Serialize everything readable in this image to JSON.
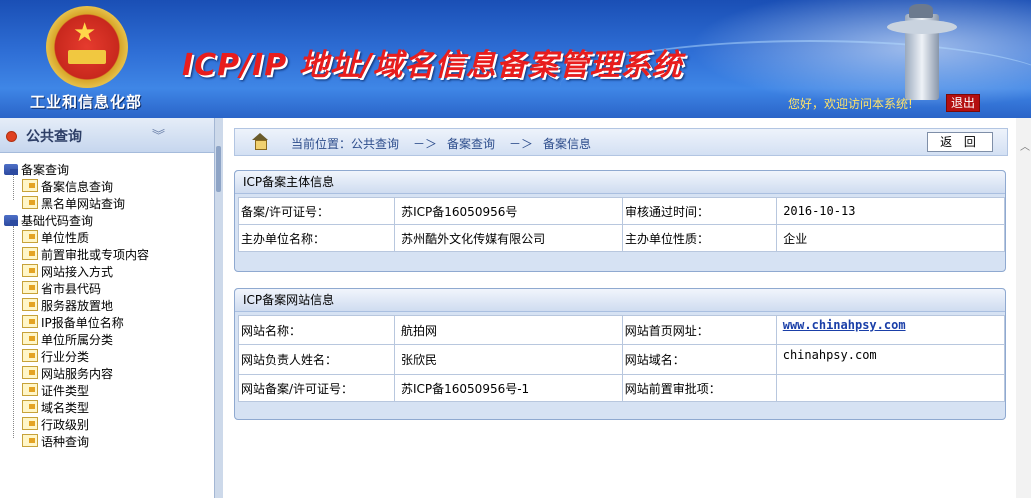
{
  "header": {
    "ministry": "工业和信息化部",
    "system_title": "ICP/IP 地址/域名信息备案管理系统",
    "welcome": "您好，欢迎访问本系统!",
    "logout_label": "退出"
  },
  "sidebar": {
    "title": "公共查询",
    "groups": [
      {
        "label": "备案查询",
        "items": [
          "备案信息查询",
          "黑名单网站查询"
        ]
      },
      {
        "label": "基础代码查询",
        "items": [
          "单位性质",
          "前置审批或专项内容",
          "网站接入方式",
          "省市县代码",
          "服务器放置地",
          "IP报备单位名称",
          "单位所属分类",
          "行业分类",
          "网站服务内容",
          "证件类型",
          "域名类型",
          "行政级别",
          "语种查询"
        ]
      }
    ]
  },
  "breadcrumb": {
    "prefix": "当前位置：",
    "items": [
      "公共查询",
      "备案查询",
      "备案信息"
    ],
    "separator": "－＞",
    "back_label": "返 回"
  },
  "subject_panel": {
    "title": "ICP备案主体信息",
    "rows": [
      {
        "label1": "备案/许可证号：",
        "value1": "苏ICP备16050956号",
        "label2": "审核通过时间：",
        "value2": "2016-10-13"
      },
      {
        "label1": "主办单位名称：",
        "value1": "苏州酷外文化传媒有限公司",
        "label2": "主办单位性质：",
        "value2": "企业"
      }
    ]
  },
  "website_panel": {
    "title": "ICP备案网站信息",
    "rows": [
      {
        "label1": "网站名称：",
        "value1": "航拍网",
        "label2": "网站首页网址：",
        "value2": "www.chinahpsy.com"
      },
      {
        "label1": "网站负责人姓名：",
        "value1": "张欣民",
        "label2": "网站域名：",
        "value2": "chinahpsy.com"
      },
      {
        "label1": "网站备案/许可证号：",
        "value1": "苏ICP备16050956号-1",
        "label2": "网站前置审批项：",
        "value2": ""
      }
    ]
  }
}
